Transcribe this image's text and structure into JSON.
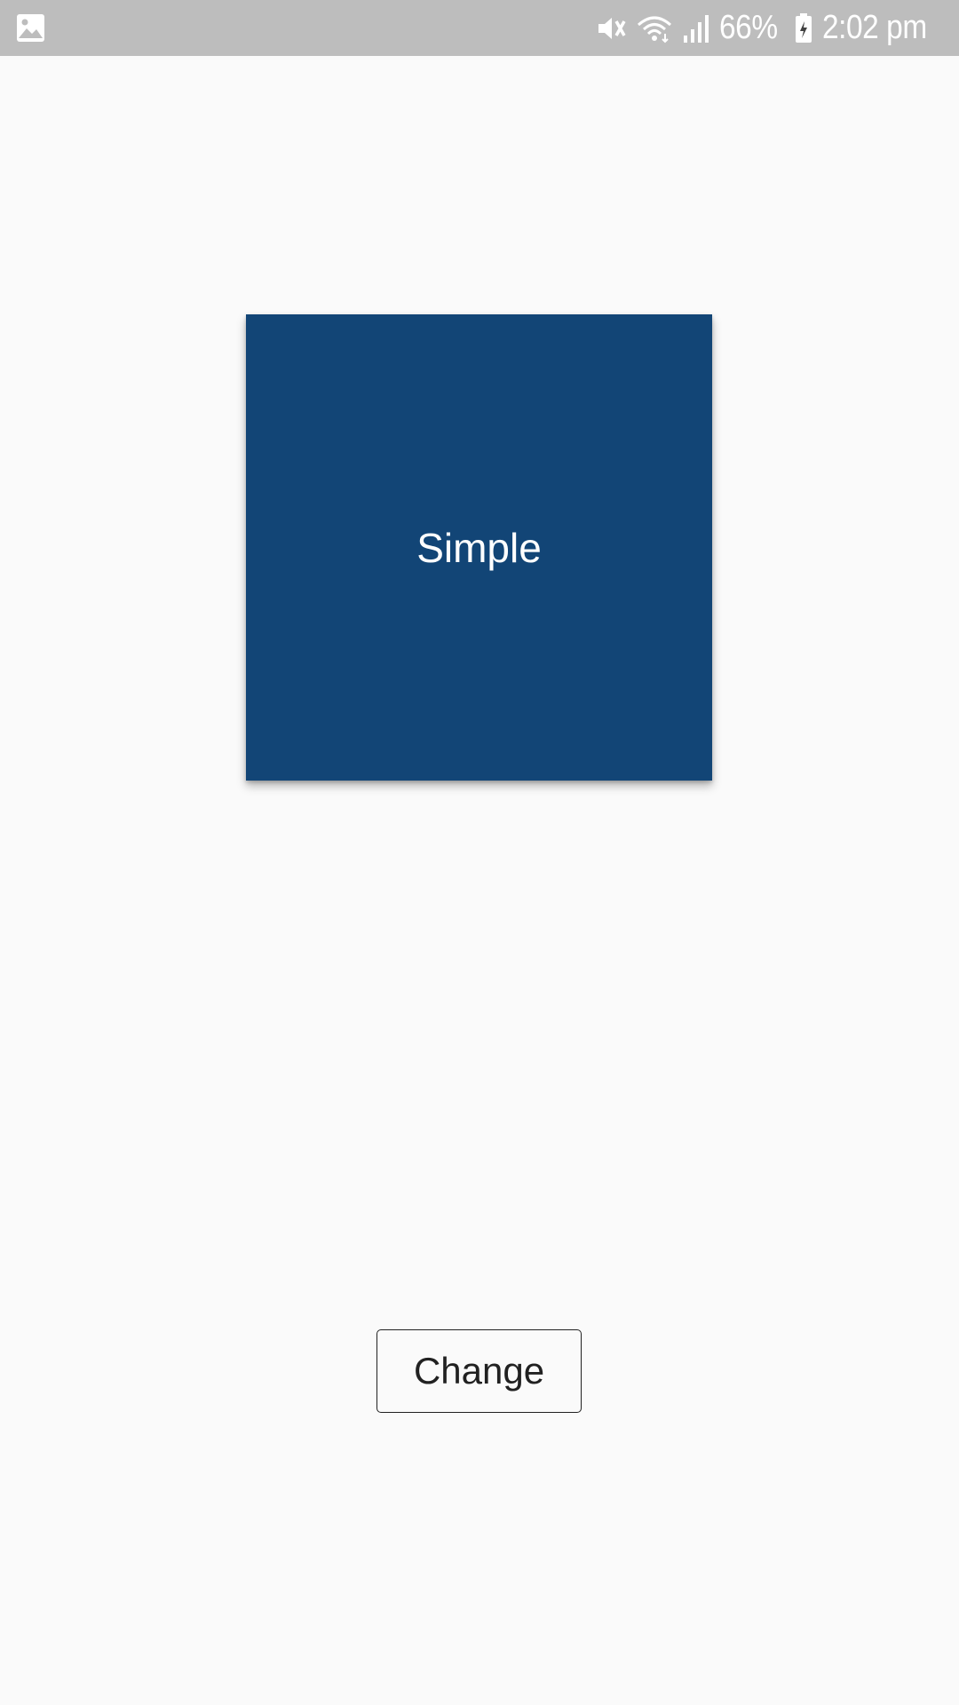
{
  "status_bar": {
    "left_icons": [
      "gallery-icon"
    ],
    "right_icons": [
      "mute-icon",
      "wifi-icon",
      "signal-icon",
      "battery-icon"
    ],
    "battery_text": "66%",
    "time": "2:02 pm",
    "background_color": "#bdbdbd"
  },
  "card": {
    "label": "Simple",
    "color": "#124576"
  },
  "button": {
    "label": "Change"
  }
}
